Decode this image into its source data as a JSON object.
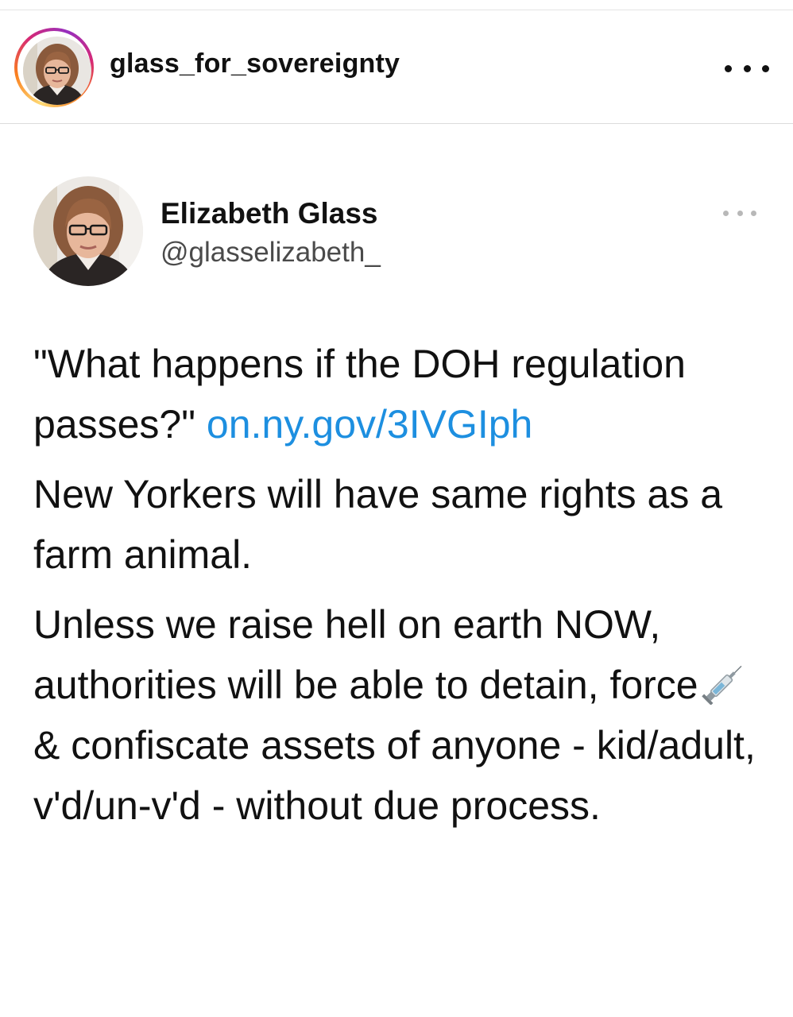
{
  "instagram_header": {
    "username": "glass_for_sovereignty",
    "more_icon": "more-horizontal-icon",
    "avatar_icon": "profile-photo"
  },
  "tweet": {
    "name": "Elizabeth Glass",
    "handle": "@glasselizabeth_",
    "more_icon": "more-horizontal-icon",
    "para1_text": "\"What happens if the DOH regulation passes?\"",
    "para1_link": "on.ny.gov/3IVGIph",
    "para2": "New Yorkers will have same rights as a farm animal.",
    "para3_before": "Unless we raise hell on earth NOW, authorities will be able to detain, force",
    "para3_emoji": "syringe-emoji",
    "para3_after": "& confiscate assets of anyone - kid/adult, v'd/un-v'd - without due process."
  },
  "colors": {
    "link": "#1d8fe0",
    "text": "#111111",
    "handle": "#4a4a4a"
  }
}
